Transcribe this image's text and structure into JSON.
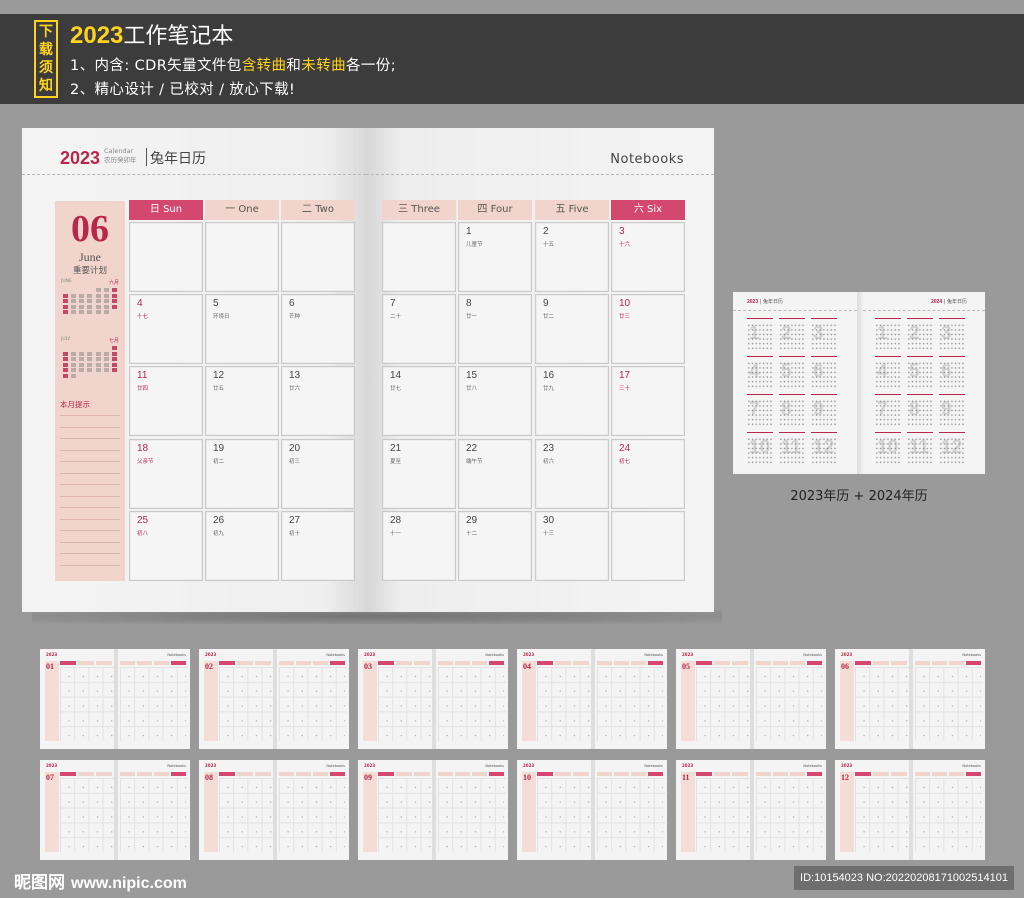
{
  "banner": {
    "tag_chars": [
      "下",
      "载",
      "须",
      "知"
    ],
    "title_year": "2023",
    "title_rest": "工作笔记本",
    "line1_a": "1、内含: CDR矢量文件包",
    "line1_hl1": "含转曲",
    "line1_b": "和",
    "line1_hl2": "未转曲",
    "line1_c": "各一份;",
    "line2": "2、精心设计 / 已校对 / 放心下载!"
  },
  "book": {
    "header_year": "2023",
    "header_calendar": "Calendar",
    "header_lunar": "农历癸卯年",
    "header_title": "兔年日历",
    "notebooks_label": "Notebooks",
    "month_number": "06",
    "month_name": "June",
    "month_subtitle": "重要计划",
    "mini_cal_1": {
      "name_en": "JUNE",
      "name_cn": "六月"
    },
    "mini_cal_2": {
      "name_en": "JULY",
      "name_cn": "七月"
    },
    "tip_label": "本月提示",
    "weekday_headers": [
      "日 Sun",
      "一 One",
      "二 Two",
      "三 Three",
      "四 Four",
      "五 Five",
      "六 Six"
    ],
    "cells": [
      {
        "n": "",
        "l": ""
      },
      {
        "n": "",
        "l": ""
      },
      {
        "n": "",
        "l": ""
      },
      {
        "n": "",
        "l": ""
      },
      {
        "n": "1",
        "l": "儿童节"
      },
      {
        "n": "2",
        "l": "十五"
      },
      {
        "n": "3",
        "l": "十六"
      },
      {
        "n": "4",
        "l": "十七"
      },
      {
        "n": "5",
        "l": "环境日"
      },
      {
        "n": "6",
        "l": "芒种"
      },
      {
        "n": "7",
        "l": "二十"
      },
      {
        "n": "8",
        "l": "廿一"
      },
      {
        "n": "9",
        "l": "廿二"
      },
      {
        "n": "10",
        "l": "廿三"
      },
      {
        "n": "11",
        "l": "廿四"
      },
      {
        "n": "12",
        "l": "廿五"
      },
      {
        "n": "13",
        "l": "廿六"
      },
      {
        "n": "14",
        "l": "廿七"
      },
      {
        "n": "15",
        "l": "廿八"
      },
      {
        "n": "16",
        "l": "廿九"
      },
      {
        "n": "17",
        "l": "三十"
      },
      {
        "n": "18",
        "l": "父亲节"
      },
      {
        "n": "19",
        "l": "初二"
      },
      {
        "n": "20",
        "l": "初三"
      },
      {
        "n": "21",
        "l": "夏至"
      },
      {
        "n": "22",
        "l": "端午节"
      },
      {
        "n": "23",
        "l": "初六"
      },
      {
        "n": "24",
        "l": "初七"
      },
      {
        "n": "25",
        "l": "初八"
      },
      {
        "n": "26",
        "l": "初九"
      },
      {
        "n": "27",
        "l": "初十"
      },
      {
        "n": "28",
        "l": "十一"
      },
      {
        "n": "29",
        "l": "十二"
      },
      {
        "n": "30",
        "l": "十三"
      },
      {
        "n": "",
        "l": ""
      }
    ]
  },
  "preview": {
    "left_year": "2023",
    "right_year": "2024",
    "header_title": "兔年日历",
    "caption": "2023年历 + 2024年历",
    "month_numbers": [
      "1",
      "2",
      "3",
      "4",
      "5",
      "6",
      "7",
      "8",
      "9",
      "10",
      "11",
      "12"
    ]
  },
  "thumbnails": {
    "months": [
      "01",
      "02",
      "03",
      "04",
      "05",
      "06",
      "07",
      "08",
      "09",
      "10",
      "11",
      "12"
    ],
    "year": "2023",
    "notebooks_label": "Notebooks"
  },
  "footer": {
    "logo_cn": "昵图网",
    "logo_url": "www.nipic.com",
    "id_text": "ID:10154023 NO:20220208171002514101"
  },
  "colors": {
    "accent": "#b8274a",
    "accent_bar": "#d4476f",
    "pink_light": "#f1d4cc",
    "banner_bg": "#3c3c3c",
    "highlight": "#ffd21e"
  }
}
